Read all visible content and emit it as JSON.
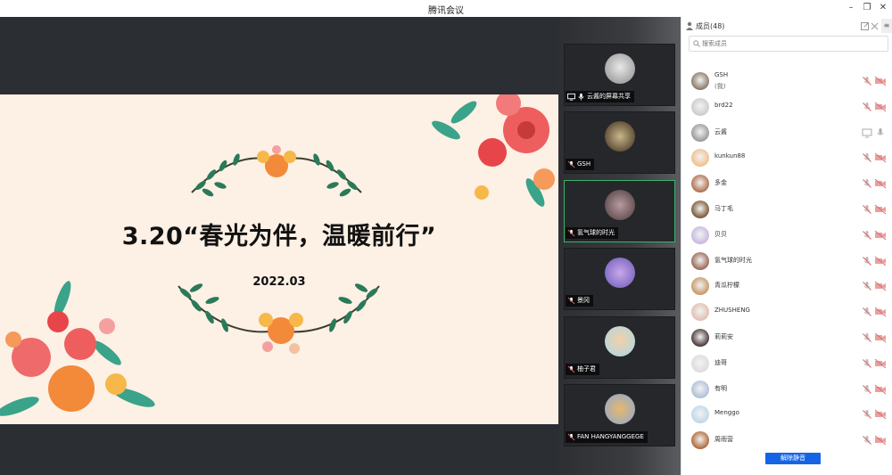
{
  "window": {
    "title": "腾讯会议"
  },
  "slide": {
    "title": "3.20“春光为伴，温暖前行”",
    "date": "2022.03"
  },
  "videos": [
    {
      "label": "云酱的屏幕共享",
      "sharing": true
    },
    {
      "label": "GSH"
    },
    {
      "label": "氢气球的时光",
      "active": true
    },
    {
      "label": "景冈"
    },
    {
      "label": "柚子君"
    },
    {
      "label": "FAN HANGYANGGEGE"
    }
  ],
  "members_panel": {
    "title": "成员(48)",
    "search_placeholder": "搜索成员",
    "unmute_all_label": "解除静音",
    "members": [
      {
        "name": "GSH",
        "note": "(我)"
      },
      {
        "name": "brd22"
      },
      {
        "name": "云酱",
        "sharing": true
      },
      {
        "name": "kunkun88"
      },
      {
        "name": "多金"
      },
      {
        "name": "马丁毛"
      },
      {
        "name": "贝贝"
      },
      {
        "name": "氢气球的时光"
      },
      {
        "name": "青瓜柠檬"
      },
      {
        "name": "ZHUSHENG"
      },
      {
        "name": "莉莉安"
      },
      {
        "name": "迪哥"
      },
      {
        "name": "有明"
      },
      {
        "name": "Menggo"
      },
      {
        "name": "周雨营"
      }
    ]
  },
  "colors": {
    "accent": "#1664e6",
    "active_border": "#3bb36a",
    "slide_bg": "#fdf0e5",
    "muted_red": "#e06a6a"
  }
}
